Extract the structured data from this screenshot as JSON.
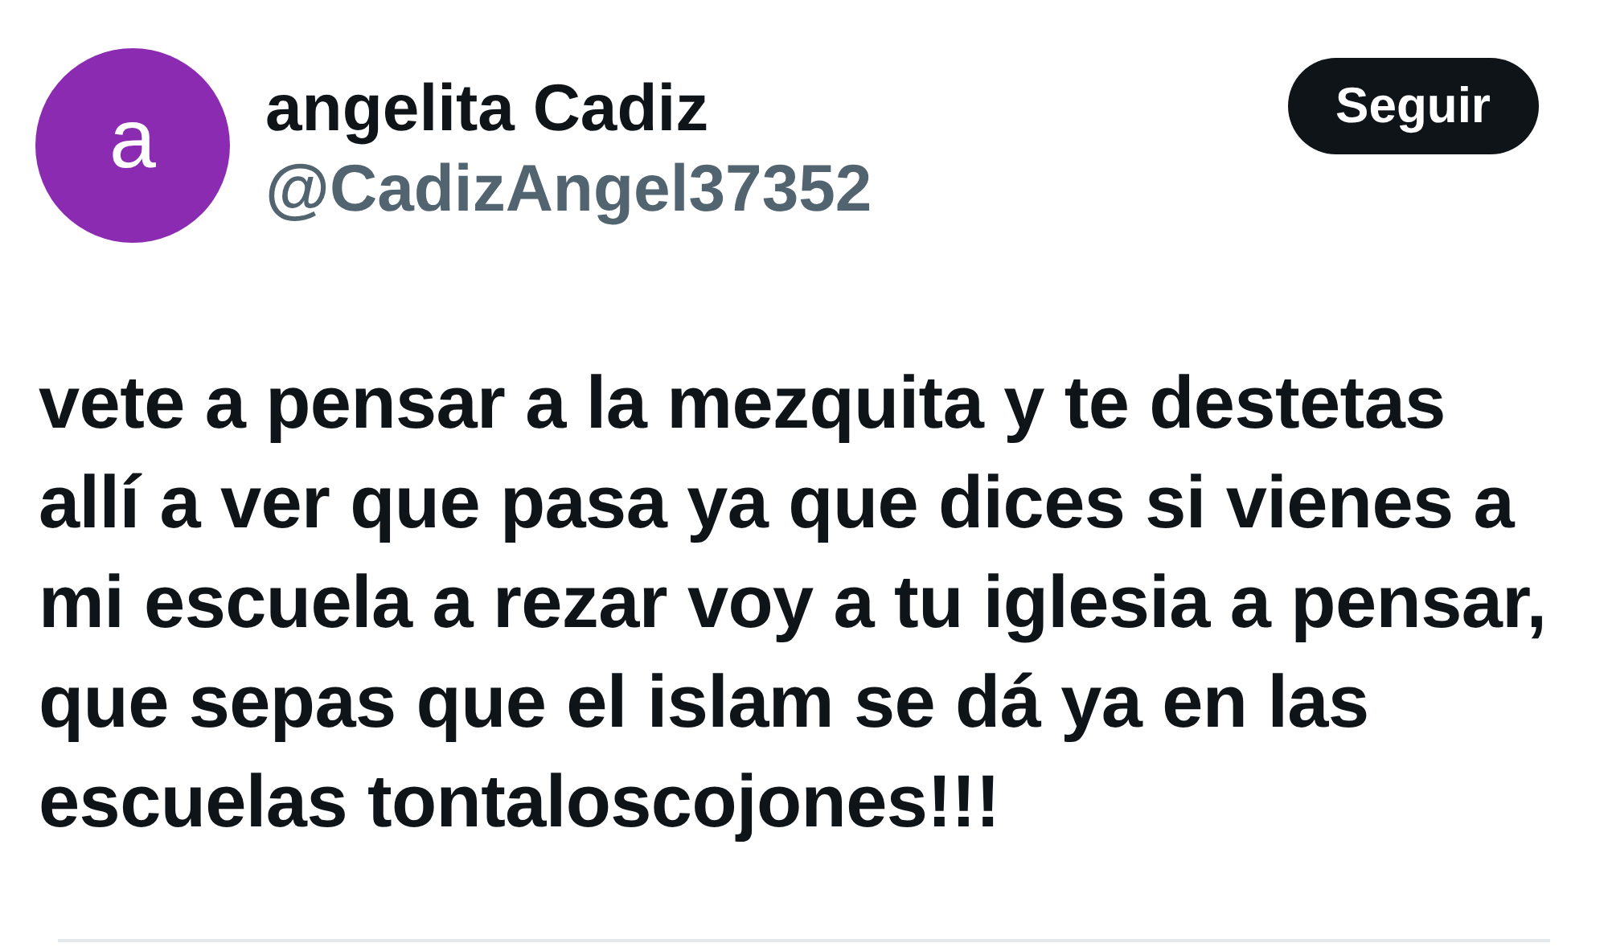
{
  "author": {
    "avatar_letter": "a",
    "name": "angelita Cadiz",
    "handle": "@CadizAngel37352"
  },
  "follow_button": {
    "label": "Seguir"
  },
  "tweet_text": "vete a pensar a la mezquita y te destetas\nallí a ver que pasa ya que dices si vienes a\nmi escuela a rezar voy a tu iglesia a pensar,\nque sepas que el islam se dá ya en las\nescuelas tontaloscojones!!!"
}
